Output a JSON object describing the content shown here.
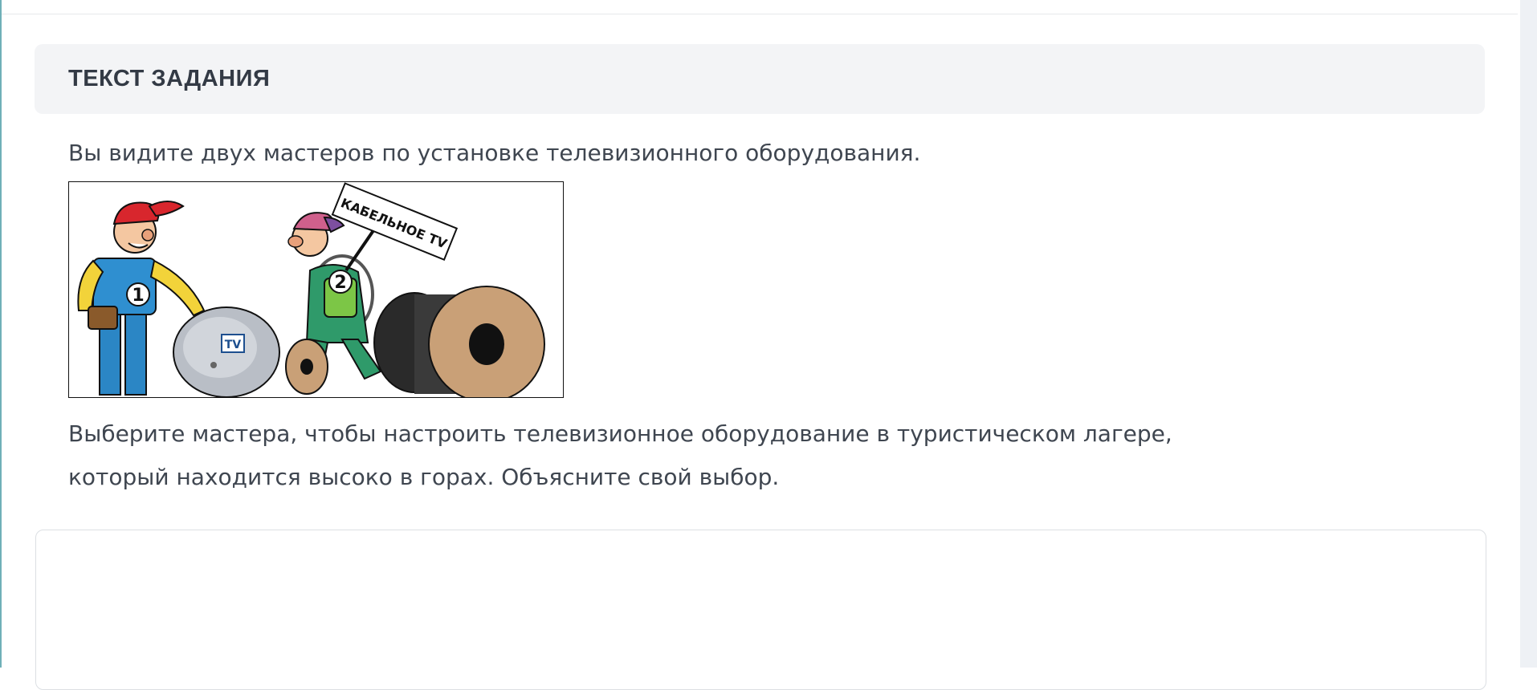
{
  "task": {
    "section_title": "ТЕКСТ ЗАДАНИЯ",
    "intro_text": "Вы видите двух мастеров по установке телевизионного оборудования.",
    "question_line_1": "Выберите мастера, чтобы настроить телевизионное оборудование в туристическом лагере,",
    "question_line_2": "который находится высоко в горах. Объясните свой выбор."
  },
  "illustration": {
    "master_1_badge": "1",
    "master_2_badge": "2",
    "sign_text": "КАБЕЛЬНОЕ TV",
    "dish_logo_text": "TV"
  },
  "answer": {
    "value": ""
  }
}
